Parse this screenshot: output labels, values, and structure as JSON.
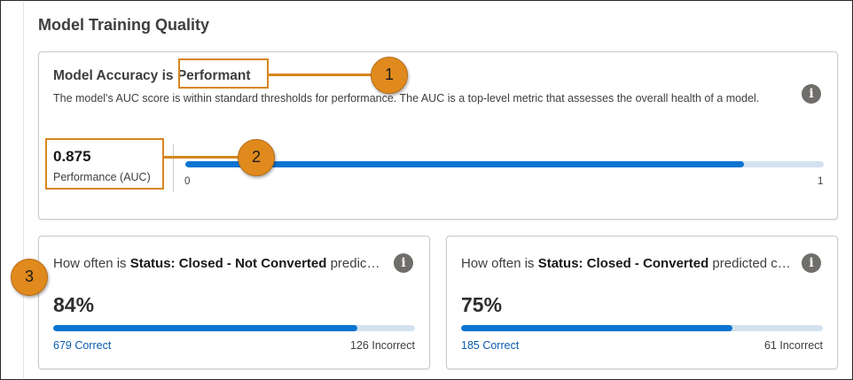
{
  "section": {
    "title": "Model Training Quality"
  },
  "accuracy_card": {
    "title_prefix": "Model Accuracy is ",
    "status": "Performant",
    "description": "The model's AUC score is within standard thresholds for performance. The AUC is a top-level metric that assesses the overall health of a model.",
    "info_icon": "info-icon",
    "metric_value": "0.875",
    "metric_label": "Performance (AUC)",
    "auc_fraction": 0.875,
    "axis_min": "0",
    "axis_max": "1"
  },
  "cards": [
    {
      "question_prefix": "How often is ",
      "question_bold": "Status: Closed - Not Converted",
      "question_suffix": " predicted correctly?",
      "percent": "84%",
      "correct": "679 Correct",
      "incorrect": "126 Incorrect",
      "info_icon": "info-icon"
    },
    {
      "question_prefix": "How often is ",
      "question_bold": "Status: Closed - Converted",
      "question_suffix": " predicted correctly?",
      "percent": "75%",
      "correct": "185 Correct",
      "incorrect": "61 Incorrect",
      "info_icon": "info-icon"
    }
  ],
  "callouts": [
    "1",
    "2",
    "3"
  ],
  "colors": {
    "accent": "#0b74d1",
    "track": "#d4e2ef",
    "link": "#0b5cab",
    "callout": "#e08a1e",
    "highlight": "#d6861e"
  }
}
